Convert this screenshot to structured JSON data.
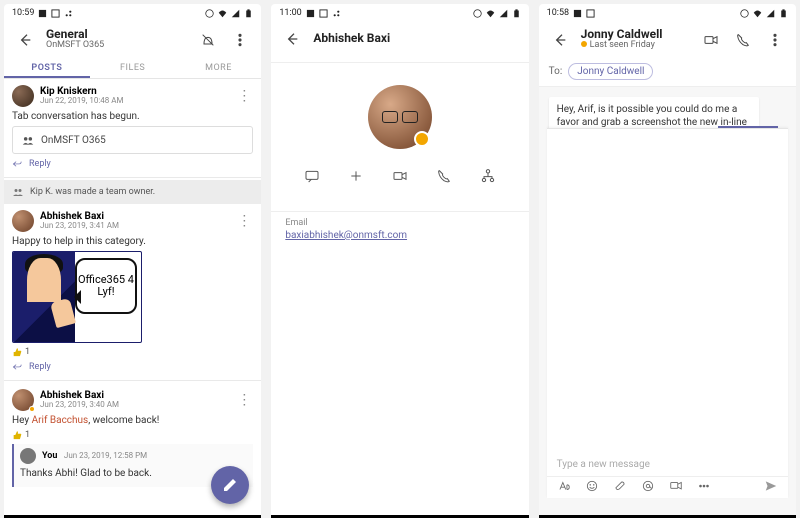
{
  "status": {
    "time_1": "10:59",
    "time_2": "11:00",
    "time_3": "10:58"
  },
  "screen1": {
    "header": {
      "title": "General",
      "subtitle": "OnMSFT O365"
    },
    "tabs": {
      "posts": "POSTS",
      "files": "FILES",
      "more": "MORE"
    },
    "posts": [
      {
        "author": "Kip Kniskern",
        "time": "Jun 22, 2019, 10:48 AM",
        "body": "Tab conversation has begun.",
        "quote": "OnMSFT O365"
      },
      {
        "author": "Abhishek Baxi",
        "time": "Jun 23, 2019, 3:41 AM",
        "body": "Happy to help in this category.",
        "sticker": "Office365 4 Lyf!",
        "likes": "1"
      },
      {
        "author": "Abhishek Baxi",
        "time": "Jun 23, 2019, 3:40 AM",
        "body_pre": "Hey ",
        "mention": "Arif Bacchus",
        "body_post": ", welcome back!",
        "likes": "1",
        "reply": {
          "author": "You",
          "time": "Jun 23, 2019, 12:58 PM",
          "body": "Thanks Abhi! Glad to be back."
        }
      }
    ],
    "system_msg": "Kip K. was made a team owner.",
    "reply_label": "Reply"
  },
  "screen2": {
    "header": {
      "title": "Abhishek Baxi"
    },
    "section": {
      "label": "Email",
      "value": "baxiabhishek@onmsft.com"
    }
  },
  "screen3": {
    "header": {
      "title": "Jonny Caldwell",
      "subtitle": "Last seen Friday"
    },
    "to_label": "To:",
    "chip": "Jonny Caldwell",
    "incoming": "Hey, Arif, is it possible you could do me a favor and grab a screenshot the new in-line messaging",
    "compose_placeholder": "Type a new message"
  }
}
